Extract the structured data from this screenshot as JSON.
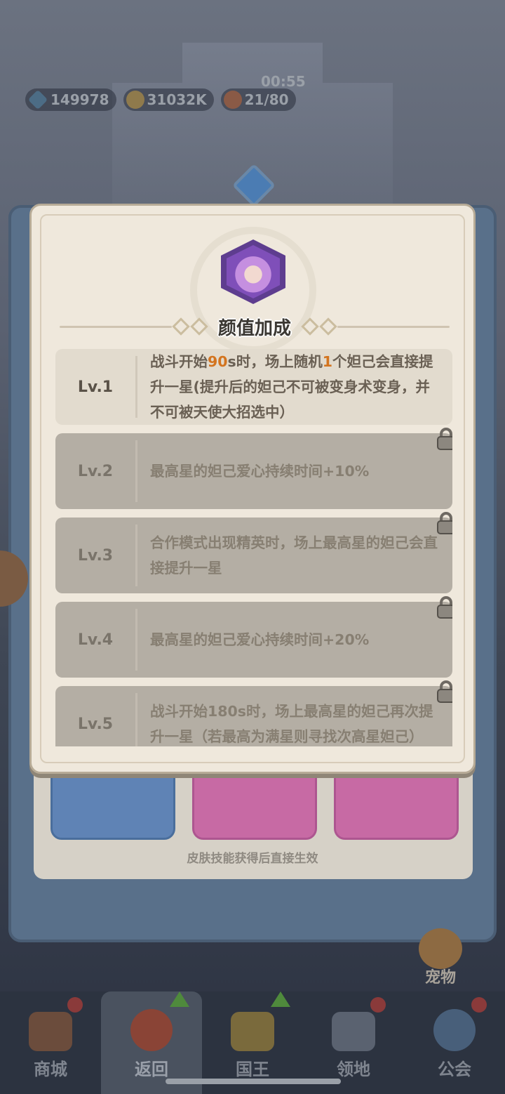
{
  "hud": {
    "gems": "149978",
    "coins": "31032K",
    "stamina": "21/80",
    "timer": "00:55"
  },
  "modal": {
    "title": "颜值加成",
    "levels": [
      {
        "label": "Lv.1",
        "locked": false,
        "parts": [
          "战斗开始",
          "90",
          "s时，场上随机",
          "1",
          "个妲己会直接提升一星(提升后的妲己不可被变身术变身，并不可被天使大招选中）"
        ]
      },
      {
        "label": "Lv.2",
        "locked": true,
        "desc": "最高星的妲己爱心持续时间+10%"
      },
      {
        "label": "Lv.3",
        "locked": true,
        "desc": "合作模式出现精英时，场上最高星的妲己会直接提升一星"
      },
      {
        "label": "Lv.4",
        "locked": true,
        "desc": "最高星的妲己爱心持续时间+20%"
      },
      {
        "label": "Lv.5",
        "locked": true,
        "desc": "战斗开始180s时，场上最高星的妲己再次提升一星（若最高为满星则寻找次高星妲己）"
      }
    ]
  },
  "skin_note": "皮肤技能获得后直接生效",
  "pet_label": "宠物",
  "nav": {
    "items": [
      {
        "label": "商城"
      },
      {
        "label": "返回"
      },
      {
        "label": "国王"
      },
      {
        "label": "领地"
      },
      {
        "label": "公会"
      }
    ]
  },
  "colors": {
    "highlight": "#d3741f",
    "modal_bg": "#efe8dc",
    "locked_row": "#b4aea4",
    "unlocked_row": "#e2dbce"
  }
}
